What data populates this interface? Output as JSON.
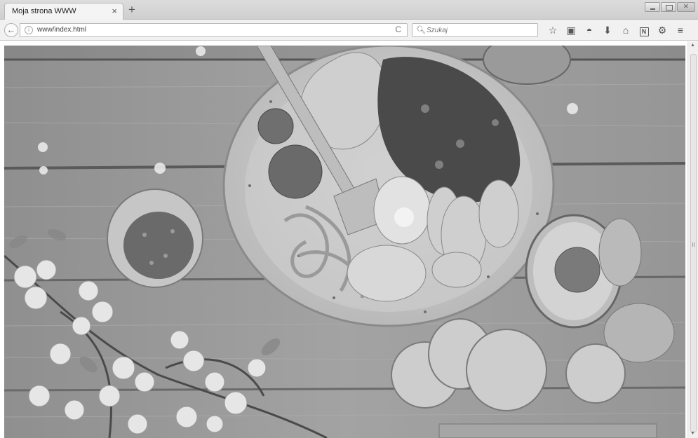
{
  "browser": {
    "tab_title": "Moja strona WWW",
    "close_symbol": "×",
    "newtab_symbol": "+",
    "url": "www/index.html",
    "reload_symbol": "C",
    "back_symbol": "←",
    "info_symbol": "i",
    "search_placeholder": "Szukaj",
    "search_symbol": "🔍︎",
    "toolbar_icons": [
      {
        "name": "bookmark-star-icon",
        "glyph": "☆"
      },
      {
        "name": "reading-list-icon",
        "glyph": "▣"
      },
      {
        "name": "pocket-icon",
        "glyph": "◓"
      },
      {
        "name": "download-icon",
        "glyph": "⬇"
      },
      {
        "name": "home-icon",
        "glyph": "⌂"
      },
      {
        "name": "extension-n-icon",
        "glyph": "N"
      },
      {
        "name": "extension-gear-icon",
        "glyph": "⚙"
      },
      {
        "name": "menu-icon",
        "glyph": "≡"
      }
    ]
  },
  "page": {
    "hero_image": "food-bowl-photo"
  }
}
